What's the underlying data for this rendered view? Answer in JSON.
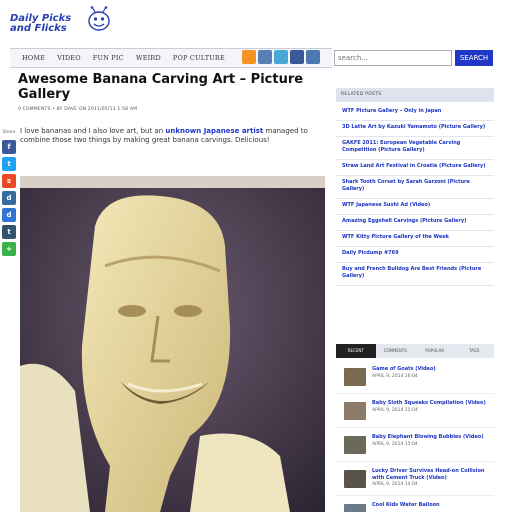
{
  "site": {
    "logo_line1": "Daily Picks",
    "logo_line2": "and Flicks"
  },
  "nav": {
    "items": [
      "HOME",
      "VIDEO",
      "FUN PIC",
      "WEIRD",
      "POP CULTURE"
    ],
    "social_icons": [
      "rss-icon",
      "stumbleupon-icon",
      "twitter-icon",
      "facebook-icon",
      "youtube-icon"
    ]
  },
  "search": {
    "placeholder": "search...",
    "button_label": "SEARCH"
  },
  "post": {
    "title": "Awesome Banana Carving Art – Picture Gallery",
    "meta": "0 COMMENTS • BY DAVE ON 2011/05/13 1:58 AM",
    "body_before_link": "I love bananas and I also love art, but an ",
    "body_link": "unknown Japanese artist",
    "body_after_link": " managed to combine those two things by making great banana carvings. Delicious!"
  },
  "share": {
    "label": "Share",
    "buttons": [
      {
        "name": "facebook-share-button",
        "glyph": "f",
        "color": "#3b5998"
      },
      {
        "name": "twitter-share-button",
        "glyph": "t",
        "color": "#1da1f2"
      },
      {
        "name": "stumbleupon-share-button",
        "glyph": "s",
        "color": "#eb4924"
      },
      {
        "name": "digg-share-button",
        "glyph": "d",
        "color": "#356aa0"
      },
      {
        "name": "delicious-share-button",
        "glyph": "d",
        "color": "#3274d1"
      },
      {
        "name": "tumblr-share-button",
        "glyph": "t",
        "color": "#34526f"
      },
      {
        "name": "more-share-button",
        "glyph": "+",
        "color": "#3cb04a"
      }
    ]
  },
  "sidebar": {
    "related_heading": "RELATED POSTS",
    "related": [
      "WTF Picture Gallery – Only in Japan",
      "3D Latte Art by Kazuki Yamamoto (Picture Gallery)",
      "GAKFE 2011: European Vegetable Carving Competition (Picture Gallery)",
      "Straw Land Art Festival in Croatia (Picture Gallery)",
      "Shark Tooth Corset by Sarah Garzoni (Picture Gallery)",
      "WTF Japanese Sushi Ad (Video)",
      "Amazing Eggshell Carvings (Picture Gallery)",
      "WTF Kitty Picture Gallery of the Week",
      "Daily Picdump #769",
      "Buy and French Bulldog Are Best Friends (Picture Gallery)"
    ],
    "tabs": [
      "RECENT",
      "COMMENTS",
      "POPULAR",
      "TAGS"
    ],
    "recent": [
      {
        "title": "Game of Goats (Video)",
        "date": "APRIL 9, 2014 16:04"
      },
      {
        "title": "Baby Sloth Squeaks Compilation (Video)",
        "date": "APRIL 9, 2014 15:04"
      },
      {
        "title": "Baby Elephant Blowing Bubbles (Video)",
        "date": "APRIL 9, 2014 15:04"
      },
      {
        "title": "Lucky Driver Survives Head-on Collision with Cement Truck (Video)",
        "date": "APRIL 9, 2014 14:04"
      },
      {
        "title": "Cool Kids Water Balloon",
        "date": ""
      }
    ]
  },
  "colors": {
    "accent": "#2038c8",
    "link": "#1a33c0"
  }
}
